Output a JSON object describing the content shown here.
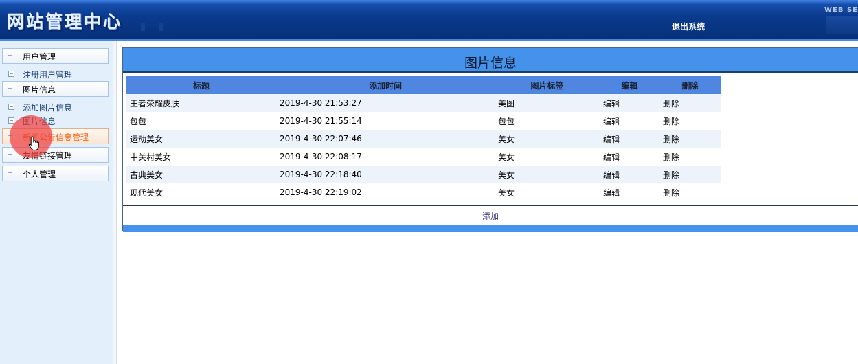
{
  "header": {
    "site_title": "网站管理中心",
    "logout_label": "退出系统",
    "web_tag": "WEB SE"
  },
  "sidebar": {
    "groups": [
      {
        "label": "用户管理",
        "items": [
          "注册用户管理"
        ]
      },
      {
        "label": "图片信息",
        "items": [
          "添加图片信息",
          "图片信息"
        ]
      },
      {
        "label": "新闻公告信息管理",
        "items": []
      },
      {
        "label": "友情链接管理",
        "items": []
      },
      {
        "label": "个人管理",
        "items": []
      }
    ],
    "active_group": "新闻公告信息管理"
  },
  "panel": {
    "title": "图片信息",
    "columns": [
      "标题",
      "添加时间",
      "图片标签",
      "编辑",
      "删除"
    ],
    "rows": [
      {
        "title": "王者荣耀皮肤",
        "time": "2019-4-30 21:53:27",
        "tag": "美图",
        "edit": "编辑",
        "delete": "删除"
      },
      {
        "title": "包包",
        "time": "2019-4-30 21:55:14",
        "tag": "包包",
        "edit": "编辑",
        "delete": "删除"
      },
      {
        "title": "运动美女",
        "time": "2019-4-30 22:07:46",
        "tag": "美女",
        "edit": "编辑",
        "delete": "删除"
      },
      {
        "title": "中关村美女",
        "time": "2019-4-30 22:08:17",
        "tag": "美女",
        "edit": "编辑",
        "delete": "删除"
      },
      {
        "title": "古典美女",
        "time": "2019-4-30 22:18:40",
        "tag": "美女",
        "edit": "编辑",
        "delete": "删除"
      },
      {
        "title": "现代美女",
        "time": "2019-4-30 22:19:02",
        "tag": "美女",
        "edit": "编辑",
        "delete": "删除"
      }
    ],
    "add_label": "添加"
  },
  "colors": {
    "header_bg": "#0b3b8e",
    "panel_title_bg": "#4492ec",
    "table_header_bg": "#4e86e0",
    "active_menu_text": "#f06a1c",
    "click_highlight": "#ee3c3c"
  },
  "icons": {
    "menu_header": "plus-icon",
    "menu_item": "minus-box-icon",
    "cursor": "hand-pointer-icon"
  }
}
